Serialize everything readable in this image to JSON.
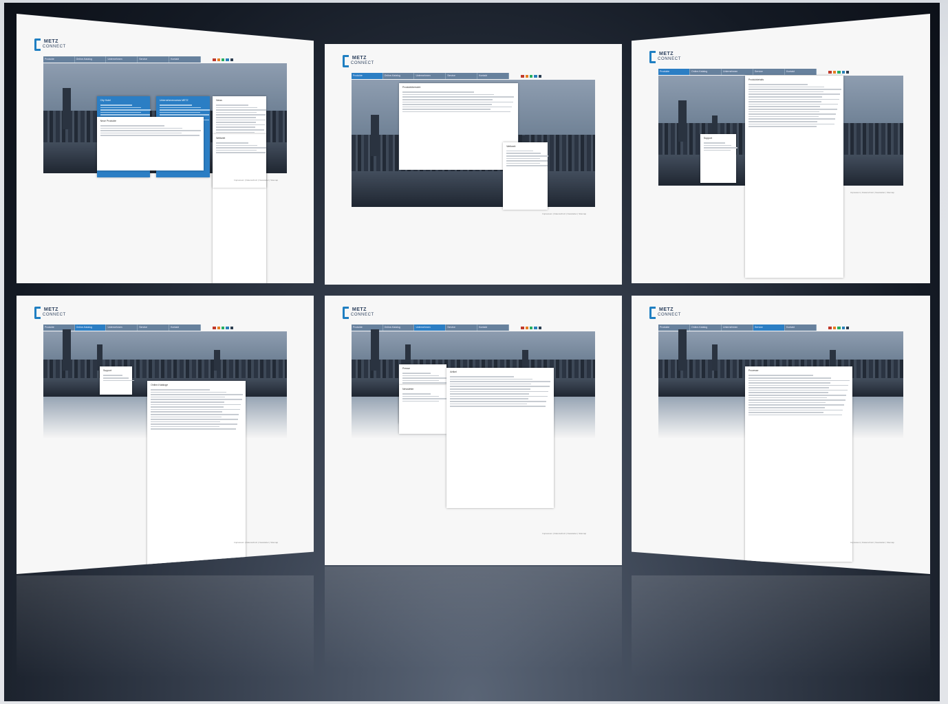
{
  "brand": {
    "name_line1": "METZ",
    "name_line2": "CONNECT",
    "accent": "#2b7ec4",
    "nav_color": "#67819d"
  },
  "panels": [
    {
      "id": "home",
      "nav": [
        "Produkte",
        "Online-Katalog",
        "Unternehmen",
        "Service",
        "Kontakt"
      ],
      "active": -1,
      "cards": [
        "City Hotel",
        "Unternehmensnews METZ",
        "News",
        "Neue Produkte",
        "Weltweit"
      ],
      "footer": "Impressum | Datenschutz | Newsletter | Sitemap"
    },
    {
      "id": "products-menu",
      "nav": [
        "Produkte",
        "Online-Katalog",
        "Unternehmen",
        "Service",
        "Kontakt"
      ],
      "active": 0,
      "cards": [
        "Produktübersicht",
        "Weltweit"
      ],
      "footer": "Impressum | Datenschutz | Newsletter | Sitemap"
    },
    {
      "id": "product-detail",
      "nav": [
        "Produkte",
        "Online-Katalog",
        "Unternehmen",
        "Service",
        "Kontakt"
      ],
      "active": 0,
      "cards": [
        "Produktdetails",
        "Support"
      ],
      "footer": "Impressum | Datenschutz | Newsletter | Sitemap"
    },
    {
      "id": "catalogs",
      "nav": [
        "Produkte",
        "Online-Katalog",
        "Unternehmen",
        "Service",
        "Kontakt"
      ],
      "active": 1,
      "cards": [
        "Support",
        "Online-Kataloge"
      ],
      "footer": "Impressum | Datenschutz | Newsletter | Sitemap"
    },
    {
      "id": "company-news",
      "nav": [
        "Produkte",
        "Online-Katalog",
        "Unternehmen",
        "Service",
        "Kontakt"
      ],
      "active": 2,
      "cards": [
        "Presse",
        "Newsletter",
        "Artikel"
      ],
      "footer": "Impressum | Datenschutz | Newsletter | Sitemap"
    },
    {
      "id": "service-form",
      "nav": [
        "Produkte",
        "Online-Katalog",
        "Unternehmen",
        "Service",
        "Kontakt"
      ],
      "active": 3,
      "cards": [
        "Prozesse"
      ],
      "footer": "Impressum | Datenschutz | Newsletter | Sitemap"
    }
  ],
  "colors": [
    "#c0392b",
    "#e67e22",
    "#27ae60",
    "#2980b9",
    "#2c3e50"
  ]
}
